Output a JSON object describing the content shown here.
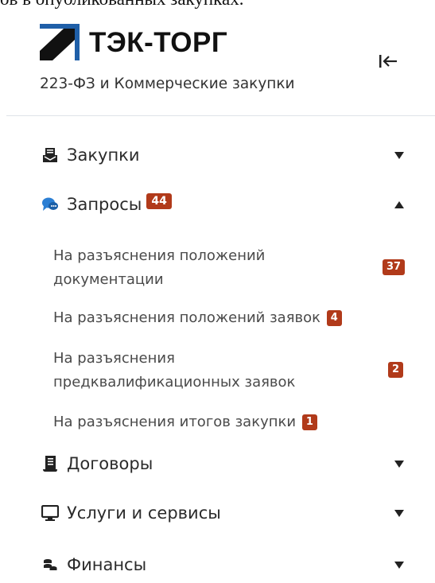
{
  "page_header_fragment": "ов в опубликованных закупках.",
  "logo": {
    "text": "ТЭК-ТОРГ"
  },
  "subtitle": "223-ФЗ и Коммерческие закупки",
  "collapse_icon": "collapse-left-icon",
  "menu": {
    "procurements": {
      "label": "Закупки",
      "icon": "procurement-icon",
      "expanded": false
    },
    "requests": {
      "label": "Запросы",
      "icon": "chat-icon",
      "badge": "44",
      "expanded": true,
      "items": [
        {
          "line1": "На разъяснения положений",
          "line2": "документации",
          "badge": "37"
        },
        {
          "line1": "На разъяснения положений заявок",
          "badge": "4"
        },
        {
          "line1": "На разъяснения",
          "line2": "предквалификационных заявок",
          "badge": "2"
        },
        {
          "line1": "На разъяснения итогов закупки",
          "badge": "1"
        }
      ]
    },
    "contracts": {
      "label": "Договоры",
      "icon": "scroll-icon",
      "expanded": false
    },
    "services": {
      "label": "Услуги и сервисы",
      "icon": "monitor-icon",
      "expanded": false
    },
    "finance": {
      "label": "Финансы",
      "icon": "coins-icon",
      "expanded": false
    }
  },
  "colors": {
    "badge": "#b13a1a",
    "logo_blue": "#1f5fa8",
    "chat_blue": "#2b7fd4"
  }
}
